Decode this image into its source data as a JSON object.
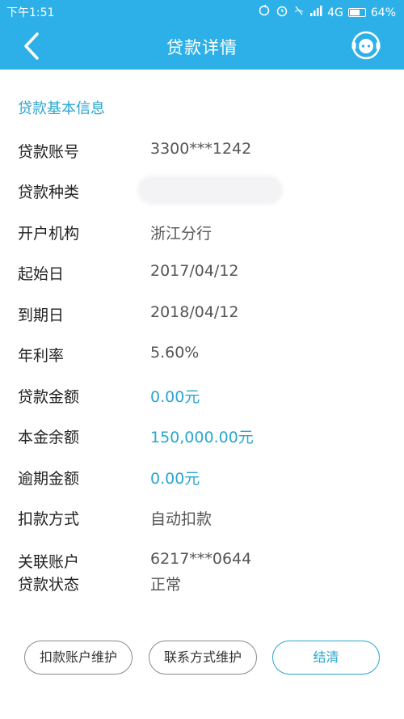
{
  "status_bar": {
    "time": "下午1:51",
    "network": "4G",
    "battery": "64%",
    "battery_level": 0.64
  },
  "nav": {
    "title": "贷款详情",
    "back_icon": "chevron-left-icon",
    "support_icon": "customer-service-icon"
  },
  "section": {
    "title": "贷款基本信息"
  },
  "fields": [
    {
      "label": "贷款账号",
      "value": "3300***1242"
    },
    {
      "label": "贷款种类",
      "value": ""
    },
    {
      "label": "开户机构",
      "value": "浙江分行"
    },
    {
      "label": "起始日",
      "value": "2017/04/12"
    },
    {
      "label": "到期日",
      "value": "2018/04/12"
    },
    {
      "label": "年利率",
      "value": "5.60%"
    },
    {
      "label": "贷款金额",
      "value": "0.00元"
    },
    {
      "label": "本金余额",
      "value": "150,000.00元"
    },
    {
      "label": "逾期金额",
      "value": "0.00元"
    },
    {
      "label": "扣款方式",
      "value": "自动扣款"
    },
    {
      "label": "关联账户",
      "value": "6217***0644"
    },
    {
      "label": "贷款状态",
      "value": "正常"
    }
  ],
  "buttons": {
    "deduct_account": "扣款账户维护",
    "contact": "联系方式维护",
    "settle": "结清"
  },
  "colors": {
    "header": "#2db0e8",
    "accent": "#2aa6cf"
  }
}
